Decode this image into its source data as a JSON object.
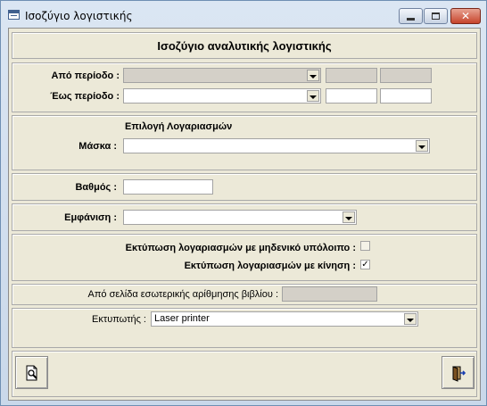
{
  "window": {
    "title": "Ισοζύγιο λογιστικής",
    "close_glyph": "✕"
  },
  "header": {
    "title": "Ισοζύγιο αναλυτικής λογιστικής"
  },
  "period": {
    "from_label": "Από περίοδο :",
    "to_label": "Έως περίοδο :"
  },
  "accounts": {
    "heading": "Επιλογή Λογαριασμών",
    "mask_label": "Μάσκα :"
  },
  "level": {
    "label": "Βαθμός :"
  },
  "display": {
    "label": "Εμφάνιση :"
  },
  "options": {
    "zero_balance_label": "Εκτύπωση λογαριασμών με μηδενικό υπόλοιπο :",
    "zero_balance_checked": false,
    "movement_label": "Εκτύπωση λογαριασμών με κίνηση :",
    "movement_checked": true,
    "check_glyph": "✓"
  },
  "page": {
    "label": "Από σελίδα εσωτερικής αρίθμησης βιβλίου :"
  },
  "printer": {
    "label": "Εκτυπωτής :",
    "value": "Laser printer"
  },
  "icons": {
    "preview": "print-preview-icon",
    "exit": "exit-door-icon"
  }
}
